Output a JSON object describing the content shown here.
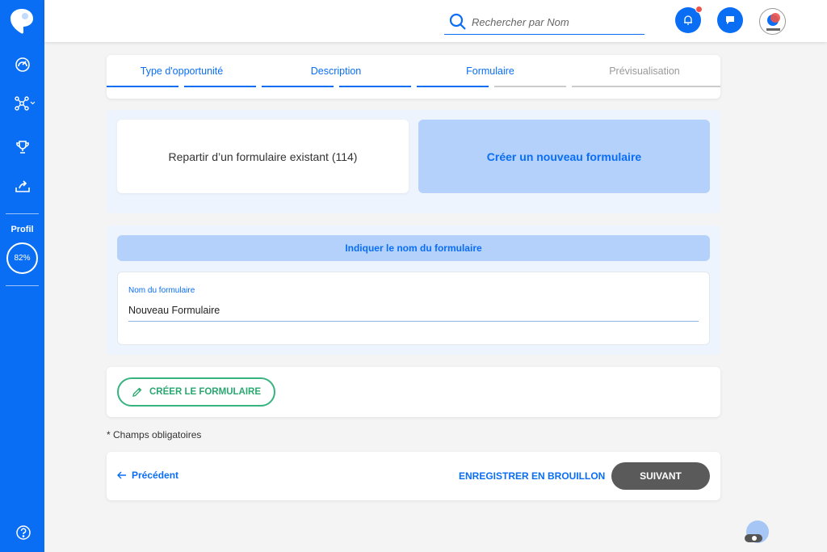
{
  "sidebar": {
    "profile_label": "Profil",
    "profile_progress": "82%",
    "items": [
      {
        "icon": "dashboard-icon"
      },
      {
        "icon": "network-icon"
      },
      {
        "icon": "trophy-icon"
      },
      {
        "icon": "share-icon"
      }
    ]
  },
  "header": {
    "search_placeholder": "Rechercher par Nom"
  },
  "stepper": {
    "steps": [
      {
        "label": "Type d'opportunité",
        "state": "done"
      },
      {
        "label": "Description",
        "state": "done"
      },
      {
        "label": "Formulaire",
        "state": "active"
      },
      {
        "label": "Prévisualisation",
        "state": "todo"
      }
    ]
  },
  "choices": {
    "existing_label": "Repartir d’un formulaire existant (114)",
    "new_label": "Créer un nouveau formulaire"
  },
  "form_name": {
    "header": "Indiquer le nom du formulaire",
    "field_label": "Nom du formulaire",
    "field_value": "Nouveau Formulaire"
  },
  "create_button_label": "CRÉER LE FORMULAIRE",
  "required_note": "* Champs obligatoires",
  "navigation": {
    "previous_label": "Précédent",
    "draft_label": "ENREGISTRER EN BROUILLON",
    "next_label": "SUIVANT"
  },
  "colors": {
    "primary": "#0a6ef5",
    "light_blue": "#b3d1fb",
    "green": "#36b37e",
    "dark_button": "#5a5a5a",
    "notification": "#f0534a"
  }
}
